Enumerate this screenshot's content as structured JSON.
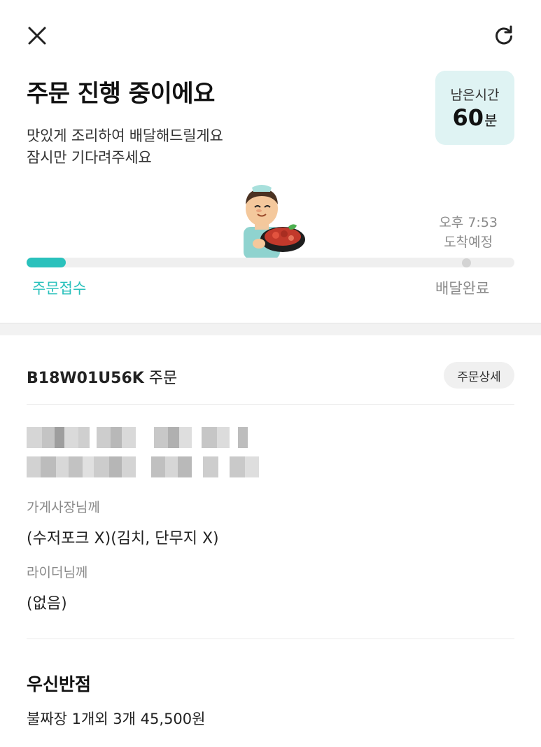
{
  "header": {
    "close_icon": "close-icon",
    "refresh_icon": "refresh-icon",
    "title": "주문 진행 중이에요",
    "subtitle_line1": "맛있게 조리하여 배달해드릴게요",
    "subtitle_line2": "잠시만 기다려주세요"
  },
  "time_card": {
    "label": "남은시간",
    "value": "60",
    "unit": "분"
  },
  "progress": {
    "eta_time": "오후 7:53",
    "eta_label": "도착예정",
    "fraction": 0.08,
    "step_start": "주문접수",
    "step_end": "배달완료",
    "accent": "#2ac1bc"
  },
  "order": {
    "id": "B18W01U56K",
    "suffix": "주문",
    "detail_button": "주문상세",
    "owner_label": "가게사장님께",
    "owner_request": "(수저포크 X)(김치, 단무지 X)",
    "rider_label": "라이더님께",
    "rider_request": "(없음)"
  },
  "store": {
    "name": "우신반점",
    "menu_summary": "불짜장 1개외 3개 45,500원"
  }
}
